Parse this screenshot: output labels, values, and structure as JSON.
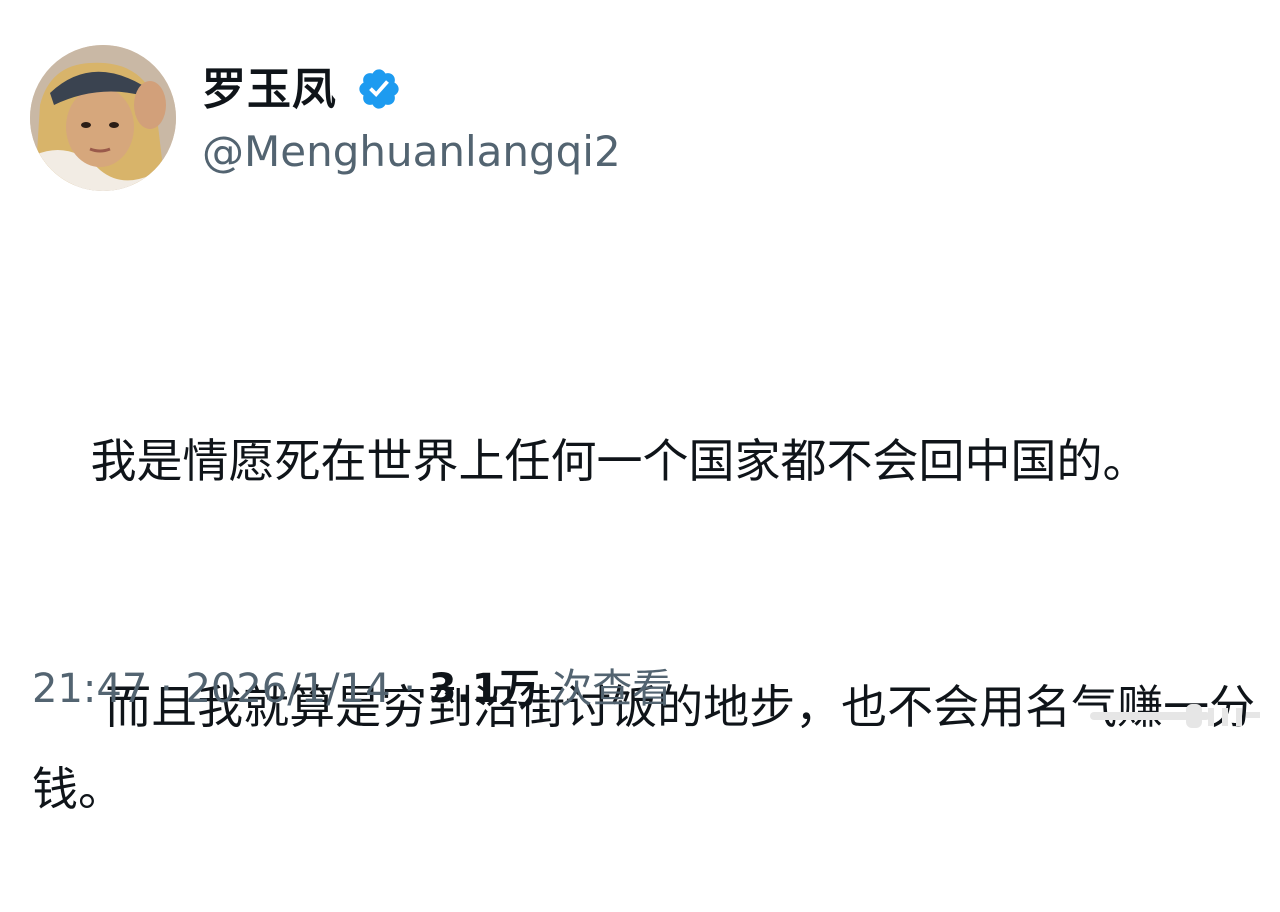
{
  "user": {
    "display_name": "罗玉凤",
    "handle": "@Menghuanlangqi2",
    "verified": true
  },
  "tweet": {
    "paragraphs": [
      "    我是情愿死在世界上任何一个国家都不会回中国的。",
      "     而且我就算是穷到沿街讨饭的地步，也不会用名气赚一分钱。"
    ]
  },
  "meta": {
    "time": "21:47",
    "separator": " · ",
    "date": "2026/1/14",
    "views_count": "3.1万",
    "views_label": " 次查看"
  },
  "colors": {
    "text": "#0f1419",
    "secondary": "#536471",
    "verified": "#1d9bf0"
  }
}
